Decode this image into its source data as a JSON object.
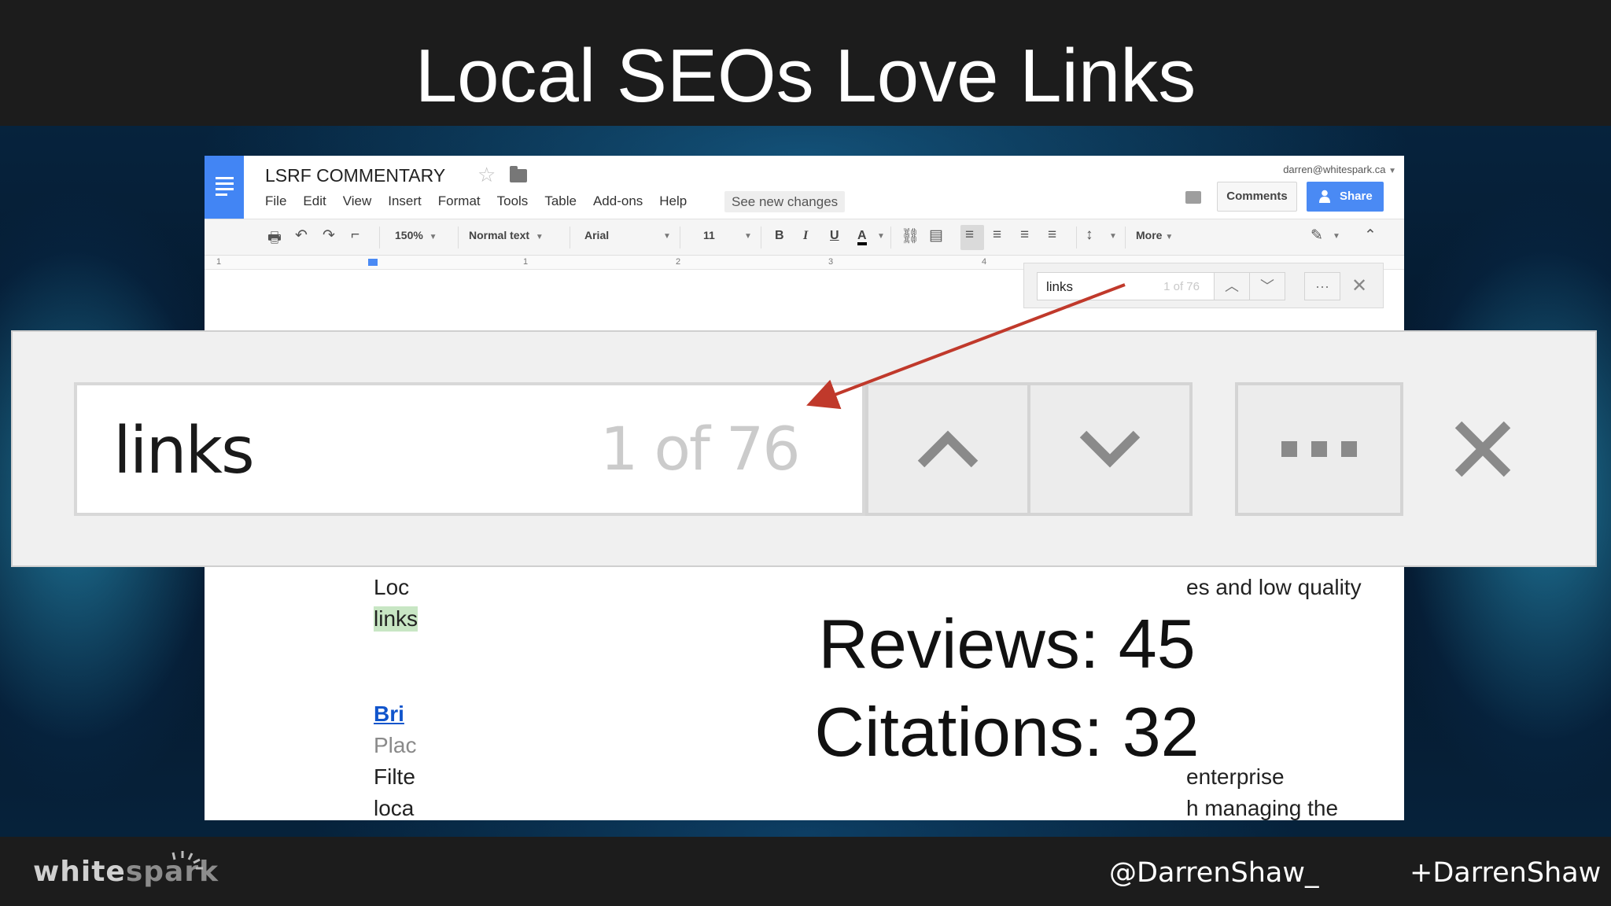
{
  "slide": {
    "title": "Local SEOs Love Links",
    "logo_white": "white",
    "logo_spark": "spark",
    "twitter_handle": "@DarrenShaw_",
    "plus_handle": "+DarrenShaw"
  },
  "doc": {
    "title": "LSRF COMMENTARY",
    "account": "darren@whitespark.ca",
    "menu": [
      "File",
      "Edit",
      "View",
      "Insert",
      "Format",
      "Tools",
      "Table",
      "Add-ons",
      "Help"
    ],
    "see_changes": "See new changes",
    "comments_label": "Comments",
    "share_label": "Share",
    "toolbar": {
      "zoom": "150%",
      "style": "Normal text",
      "font": "Arial",
      "size": "11",
      "bold": "B",
      "italic": "I",
      "underline": "U",
      "text_color": "A",
      "more": "More"
    },
    "ruler_numbers": [
      "1",
      "1",
      "2",
      "3",
      "4"
    ],
    "body_fragments": {
      "loc": "Loc",
      "links": "links",
      "bri": "Bri",
      "plac": "Plac",
      "filte": "Filte",
      "loca": "loca",
      "right1": "es and low quality",
      "right2": "enterprise",
      "right3": "h managing the"
    }
  },
  "find": {
    "query": "links",
    "count": "1 of 76"
  },
  "stats": {
    "reviews": "Reviews: 45",
    "citations": "Citations: 32"
  },
  "colors": {
    "accent_blue": "#4285f4",
    "arrow_red": "#c0392b",
    "highlight_green": "#c8e6c4"
  }
}
